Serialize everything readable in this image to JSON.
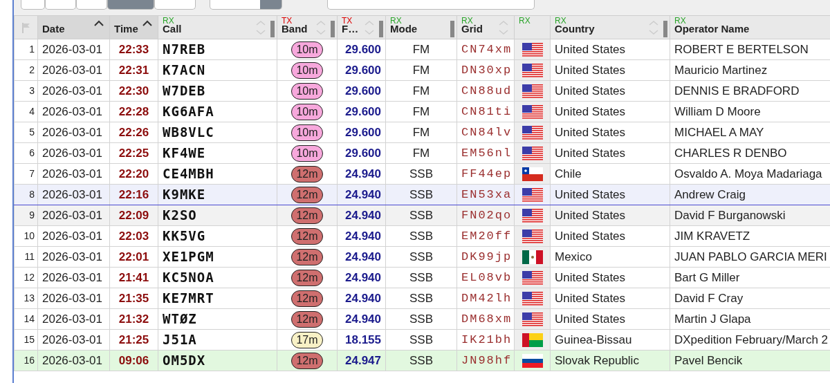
{
  "toolbar": [
    {
      "selected": false
    },
    {
      "selected": false
    },
    {
      "selected": false
    },
    {
      "selected": true
    },
    {
      "selected": false
    }
  ],
  "columns": [
    {
      "kind": "flag"
    },
    {
      "kind": "text",
      "label": "Date",
      "sorted": true,
      "sortable": true
    },
    {
      "kind": "text",
      "label": "Time",
      "sorted": true,
      "sortable": true
    },
    {
      "kind": "text",
      "label": "Call",
      "tag": "RX",
      "sorted": false,
      "sortable": true,
      "handle": true
    },
    {
      "kind": "text",
      "label": "Band",
      "tag": "TX",
      "sorted": false,
      "sortable": true,
      "handle": true
    },
    {
      "kind": "text",
      "label": "F…",
      "tag": "TX",
      "sorted": false,
      "sortable": true,
      "handle": true
    },
    {
      "kind": "text",
      "label": "Mode",
      "tag": "RX",
      "handle": true
    },
    {
      "kind": "text",
      "label": "Grid",
      "tag": "RX",
      "sorted": false,
      "sortable": true
    },
    {
      "kind": "text",
      "tag": "RX"
    },
    {
      "kind": "text",
      "label": "Country",
      "tag": "RX",
      "sorted": false,
      "sortable": true,
      "handle": true
    },
    {
      "kind": "text",
      "label": "Operator Name",
      "tag": "RX"
    }
  ],
  "rows": [
    {
      "num": "1",
      "date": "2026-03-01",
      "time": "22:33",
      "call": "N7REB",
      "band": {
        "label": "10m",
        "color": "#f7a8dc"
      },
      "freq": "29.600",
      "mode": "FM",
      "grid": "CN74xm",
      "flag": {
        "kind": "us"
      },
      "country": "United States",
      "operator": "ROBERT E BERTELSON",
      "selected": false
    },
    {
      "num": "2",
      "date": "2026-03-01",
      "time": "22:31",
      "call": "K7ACN",
      "band": {
        "label": "10m",
        "color": "#f7a8dc"
      },
      "freq": "29.600",
      "mode": "FM",
      "grid": "DN30xp",
      "flag": {
        "kind": "us"
      },
      "country": "United States",
      "operator": "Mauricio Martinez",
      "selected": false
    },
    {
      "num": "3",
      "date": "2026-03-01",
      "time": "22:30",
      "call": "W7DEB",
      "band": {
        "label": "10m",
        "color": "#f7a8dc"
      },
      "freq": "29.600",
      "mode": "FM",
      "grid": "CN88ud",
      "flag": {
        "kind": "us"
      },
      "country": "United States",
      "operator": "DENNIS E BRADFORD",
      "selected": false
    },
    {
      "num": "4",
      "date": "2026-03-01",
      "time": "22:28",
      "call": "KG6AFA",
      "band": {
        "label": "10m",
        "color": "#f7a8dc"
      },
      "freq": "29.600",
      "mode": "FM",
      "grid": "CN81ti",
      "flag": {
        "kind": "us"
      },
      "country": "United States",
      "operator": "William D Moore",
      "selected": false
    },
    {
      "num": "5",
      "date": "2026-03-01",
      "time": "22:26",
      "call": "WB8VLC",
      "band": {
        "label": "10m",
        "color": "#f7a8dc"
      },
      "freq": "29.600",
      "mode": "FM",
      "grid": "CN84lv",
      "flag": {
        "kind": "us"
      },
      "country": "United States",
      "operator": "MICHAEL A MAY",
      "selected": false
    },
    {
      "num": "6",
      "date": "2026-03-01",
      "time": "22:25",
      "call": "KF4WE",
      "band": {
        "label": "10m",
        "color": "#f7a8dc"
      },
      "freq": "29.600",
      "mode": "FM",
      "grid": "EM56nl",
      "flag": {
        "kind": "us"
      },
      "country": "United States",
      "operator": "CHARLES R DENBO",
      "selected": false
    },
    {
      "num": "7",
      "date": "2026-03-01",
      "time": "22:20",
      "call": "CE4MBH",
      "band": {
        "label": "12m",
        "color": "#cf6f6f"
      },
      "freq": "24.940",
      "mode": "SSB",
      "grid": "FF44ep",
      "flag": {
        "kind": "cl"
      },
      "country": "Chile",
      "operator": "Osvaldo A. Moya Madariaga",
      "selected": false
    },
    {
      "num": "8",
      "date": "2026-03-01",
      "time": "22:16",
      "call": "K9MKE",
      "band": {
        "label": "12m",
        "color": "#cf6f6f"
      },
      "freq": "24.940",
      "mode": "SSB",
      "grid": "EN53xa",
      "flag": {
        "kind": "us"
      },
      "country": "United States",
      "operator": "Andrew Craig",
      "selected": true
    },
    {
      "num": "9",
      "date": "2026-03-01",
      "time": "22:09",
      "call": "K2SO",
      "band": {
        "label": "12m",
        "color": "#cf6f6f"
      },
      "freq": "24.940",
      "mode": "SSB",
      "grid": "FN02qo",
      "flag": {
        "kind": "us"
      },
      "country": "United States",
      "operator": "David F Burganowski",
      "selected": false,
      "color": "#f2f2f2"
    },
    {
      "num": "10",
      "date": "2026-03-01",
      "time": "22:03",
      "call": "KK5VG",
      "band": {
        "label": "12m",
        "color": "#cf6f6f"
      },
      "freq": "24.940",
      "mode": "SSB",
      "grid": "EM20ff",
      "flag": {
        "kind": "us"
      },
      "country": "United States",
      "operator": "JIM KRAVETZ",
      "selected": false
    },
    {
      "num": "11",
      "date": "2026-03-01",
      "time": "22:01",
      "call": "XE1PGM",
      "band": {
        "label": "12m",
        "color": "#cf6f6f"
      },
      "freq": "24.940",
      "mode": "SSB",
      "grid": "DK99jp",
      "flag": {
        "kind": "mx"
      },
      "country": "Mexico",
      "operator": "JUAN PABLO GARCIA MERI",
      "selected": false
    },
    {
      "num": "12",
      "date": "2026-03-01",
      "time": "21:41",
      "call": "KC5NOA",
      "band": {
        "label": "12m",
        "color": "#cf6f6f"
      },
      "freq": "24.940",
      "mode": "SSB",
      "grid": "EL08vb",
      "flag": {
        "kind": "us"
      },
      "country": "United States",
      "operator": "Bart G Miller",
      "selected": false
    },
    {
      "num": "13",
      "date": "2026-03-01",
      "time": "21:35",
      "call": "KE7MRT",
      "band": {
        "label": "12m",
        "color": "#cf6f6f"
      },
      "freq": "24.940",
      "mode": "SSB",
      "grid": "DM42lh",
      "flag": {
        "kind": "us"
      },
      "country": "United States",
      "operator": "David F Cray",
      "selected": false
    },
    {
      "num": "14",
      "date": "2026-03-01",
      "time": "21:32",
      "call": "WTØZ",
      "band": {
        "label": "12m",
        "color": "#cf6f6f"
      },
      "freq": "24.940",
      "mode": "SSB",
      "grid": "DM68xm",
      "flag": {
        "kind": "us"
      },
      "country": "United States",
      "operator": "Martin J Glapa",
      "selected": false
    },
    {
      "num": "15",
      "date": "2026-03-01",
      "time": "21:25",
      "call": "J51A",
      "band": {
        "label": "17m",
        "color": "#f8f1c6"
      },
      "freq": "18.155",
      "mode": "SSB",
      "grid": "IK21bh",
      "flag": {
        "kind": "gw"
      },
      "country": "Guinea-Bissau",
      "operator": "DXpedition February/March 2",
      "selected": false
    },
    {
      "num": "16",
      "date": "2026-03-01",
      "time": "09:06",
      "call": "OM5DX",
      "band": {
        "label": "12m",
        "color": "#cf6f6f"
      },
      "freq": "24.947",
      "mode": "SSB",
      "grid": "JN98hf",
      "flag": {
        "kind": "sk"
      },
      "country": "Slovak Republic",
      "operator": "Pavel Bencik",
      "selected": false,
      "color": "#e2f8df"
    }
  ]
}
